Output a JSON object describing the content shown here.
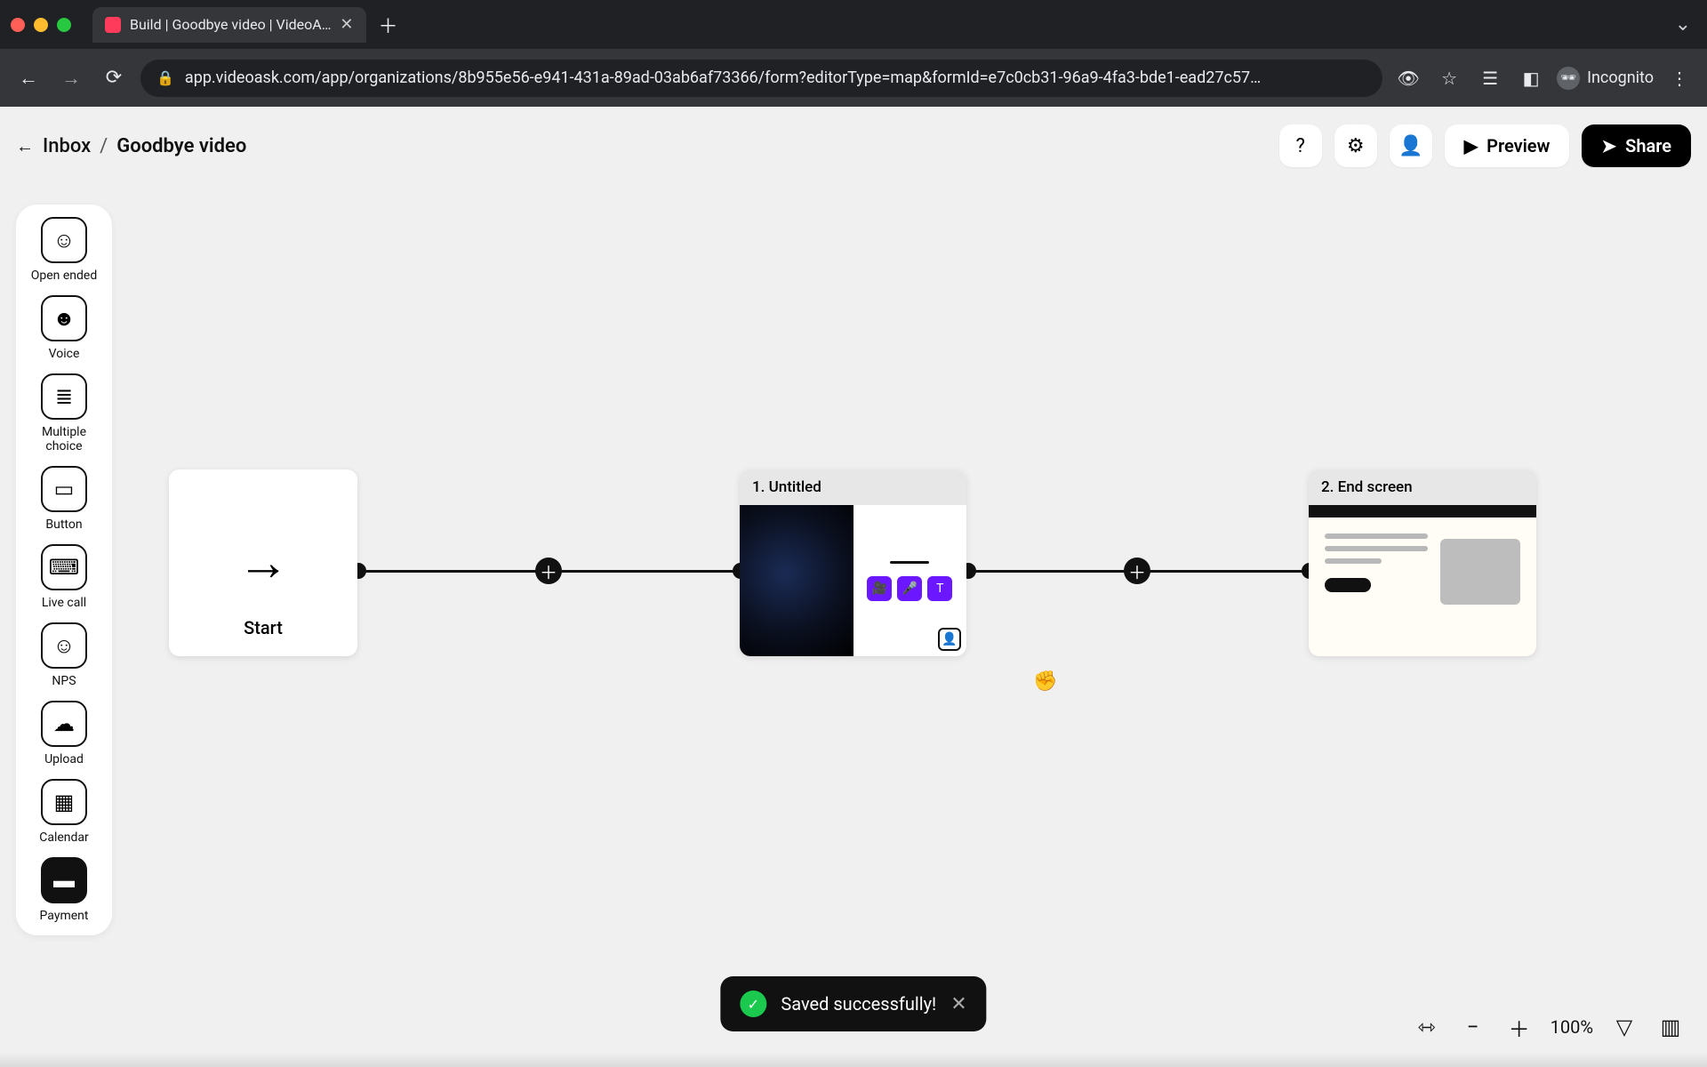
{
  "browser": {
    "tab_title": "Build | Goodbye video | VideoA…",
    "url": "app.videoask.com/app/organizations/8b955e56-e941-431a-89ad-03ab6af73366/form?editorType=map&formId=e7c0cb31-96a9-4fa3-bde1-ead27c57…",
    "incognito_label": "Incognito"
  },
  "breadcrumb": {
    "back_label": "Inbox",
    "current": "Goodbye video"
  },
  "topbar": {
    "preview_label": "Preview",
    "share_label": "Share"
  },
  "toolbar": [
    {
      "id": "open-ended",
      "label": "Open ended",
      "glyph": "☺"
    },
    {
      "id": "voice",
      "label": "Voice",
      "glyph": "☻"
    },
    {
      "id": "multiple",
      "label": "Multiple choice",
      "glyph": "≣"
    },
    {
      "id": "button",
      "label": "Button",
      "glyph": "▭"
    },
    {
      "id": "livecall",
      "label": "Live call",
      "glyph": "⌨"
    },
    {
      "id": "nps",
      "label": "NPS",
      "glyph": "☺"
    },
    {
      "id": "upload",
      "label": "Upload",
      "glyph": "☁"
    },
    {
      "id": "calendar",
      "label": "Calendar",
      "glyph": "▦"
    },
    {
      "id": "payment",
      "label": "Payment",
      "glyph": "▬"
    }
  ],
  "canvas": {
    "start_label": "Start",
    "step1_title": "1. Untitled",
    "end_title": "2. End screen"
  },
  "toast": {
    "message": "Saved successfully!"
  },
  "view": {
    "zoom": "100%"
  }
}
